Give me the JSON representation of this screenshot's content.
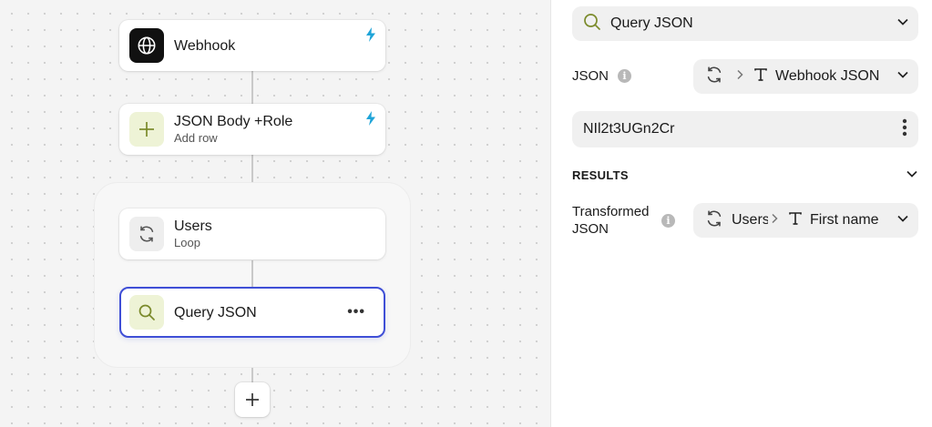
{
  "canvas": {
    "nodes": [
      {
        "title": "Webhook",
        "subtitle": "",
        "icon": "globe-icon",
        "trigger": true
      },
      {
        "title": "JSON Body +Role",
        "subtitle": "Add row",
        "icon": "plus-icon",
        "trigger": true
      },
      {
        "title": "Users",
        "subtitle": "Loop",
        "icon": "loop-icon",
        "trigger": false
      },
      {
        "title": "Query JSON",
        "subtitle": "",
        "icon": "search-icon",
        "selected": true,
        "menu": "•••"
      }
    ],
    "add_button": "+"
  },
  "panel": {
    "step_name": "Query JSON",
    "json_label": "JSON",
    "json_source": "Webhook JSON",
    "json_value": "NIl2t3UGn2Cr",
    "results_header": "RESULTS",
    "transformed_label_line1": "Transformed",
    "transformed_label_line2": "JSON",
    "transformed_path": "Users",
    "transformed_field": "First name"
  },
  "colors": {
    "selected_border": "#3f4fd6",
    "bolt": "#1fa4d8",
    "lime_icon_bg": "#eef3d6",
    "lime_icon": "#7a8a2a"
  }
}
